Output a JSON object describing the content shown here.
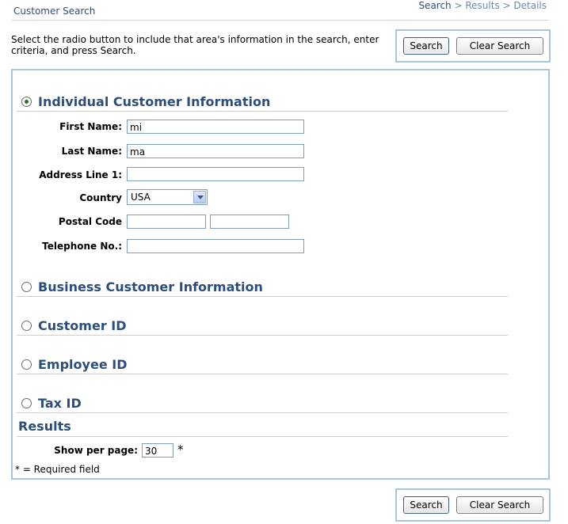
{
  "header": {
    "title": "Customer Search",
    "breadcrumb": {
      "current": "Search",
      "separator1": " > ",
      "step2": "Results",
      "separator2": " > ",
      "step3": "Details"
    }
  },
  "instructions": "Select the radio button to include that area's information in the search, enter criteria, and press Search.",
  "buttons": {
    "search": "Search",
    "clear_search": "Clear Search"
  },
  "sections": {
    "individual": {
      "label": "Individual Customer Information",
      "selected": true
    },
    "business": {
      "label": "Business Customer Information",
      "selected": false
    },
    "customer_id": {
      "label": "Customer ID",
      "selected": false
    },
    "employee_id": {
      "label": "Employee ID",
      "selected": false
    },
    "tax_id": {
      "label": "Tax ID",
      "selected": false
    }
  },
  "fields": {
    "first_name": {
      "label": "First Name:",
      "value": "mi"
    },
    "last_name": {
      "label": "Last Name:",
      "value": "ma"
    },
    "address1": {
      "label": "Address Line 1:",
      "value": ""
    },
    "country": {
      "label": "Country",
      "value": "USA"
    },
    "postal_code": {
      "label": "Postal Code",
      "value1": "",
      "value2": ""
    },
    "telephone": {
      "label": "Telephone No.:",
      "value": ""
    }
  },
  "results": {
    "title": "Results",
    "per_page_label": "Show per page:",
    "per_page_value": "30",
    "required_mark": "*"
  },
  "footnote": "* = Required field",
  "colors": {
    "accent": "#2b4f7a",
    "box_border": "#a9c4dd"
  }
}
